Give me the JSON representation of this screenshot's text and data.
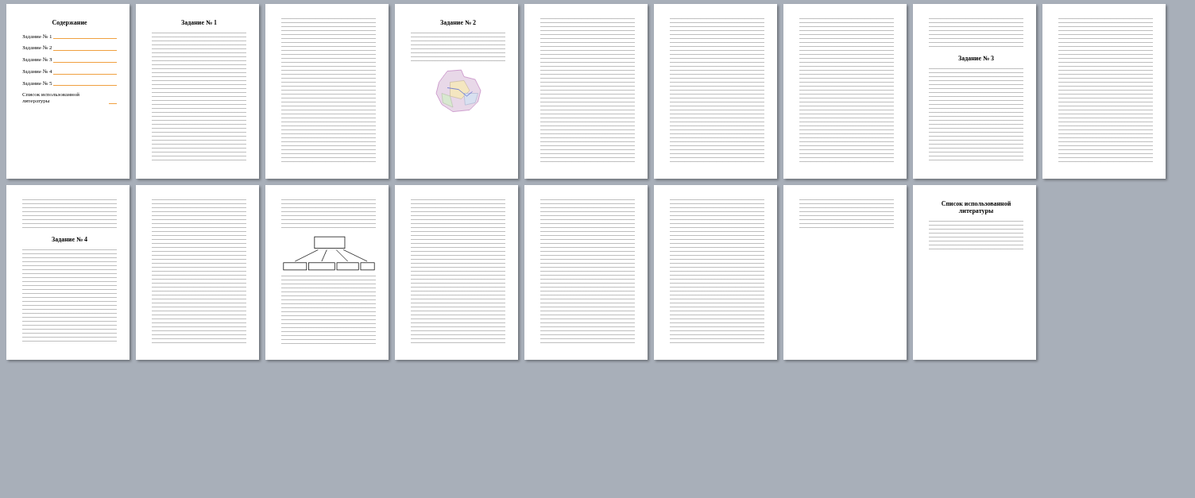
{
  "pages": [
    {
      "blocks": [
        {
          "kind": "heading",
          "text": "Содержание"
        },
        {
          "kind": "toc",
          "entries": [
            "Задание № 1",
            "Задание № 2",
            "Задание № 3",
            "Задание № 4",
            "Задание № 5",
            "Список использованной литературы"
          ]
        }
      ]
    },
    {
      "blocks": [
        {
          "kind": "heading",
          "text": "Задание № 1"
        },
        {
          "kind": "fill"
        }
      ]
    },
    {
      "blocks": [
        {
          "kind": "fill"
        }
      ]
    },
    {
      "blocks": [
        {
          "kind": "heading",
          "text": "Задание № 2"
        },
        {
          "kind": "paragraph"
        },
        {
          "kind": "map"
        }
      ]
    },
    {
      "blocks": [
        {
          "kind": "fill"
        }
      ]
    },
    {
      "blocks": [
        {
          "kind": "fill"
        }
      ]
    },
    {
      "blocks": [
        {
          "kind": "fill"
        }
      ]
    },
    {
      "blocks": [
        {
          "kind": "paragraph"
        },
        {
          "kind": "heading",
          "text": "Задание № 3"
        },
        {
          "kind": "fill"
        }
      ]
    },
    {
      "blocks": [
        {
          "kind": "fill"
        }
      ]
    },
    {
      "blocks": [
        {
          "kind": "paragraph"
        },
        {
          "kind": "heading",
          "text": "Задание № 4"
        },
        {
          "kind": "fill"
        }
      ]
    },
    {
      "blocks": [
        {
          "kind": "fill"
        }
      ]
    },
    {
      "blocks": [
        {
          "kind": "paragraph"
        },
        {
          "kind": "diagram"
        },
        {
          "kind": "fill"
        }
      ]
    },
    {
      "blocks": [
        {
          "kind": "fill"
        }
      ]
    },
    {
      "blocks": [
        {
          "kind": "fill"
        }
      ]
    },
    {
      "blocks": [
        {
          "kind": "fill"
        }
      ]
    },
    {
      "blocks": [
        {
          "kind": "paragraph"
        }
      ]
    },
    {
      "blocks": [
        {
          "kind": "heading",
          "text": "Список использованной литературы"
        },
        {
          "kind": "paragraph"
        }
      ]
    }
  ]
}
